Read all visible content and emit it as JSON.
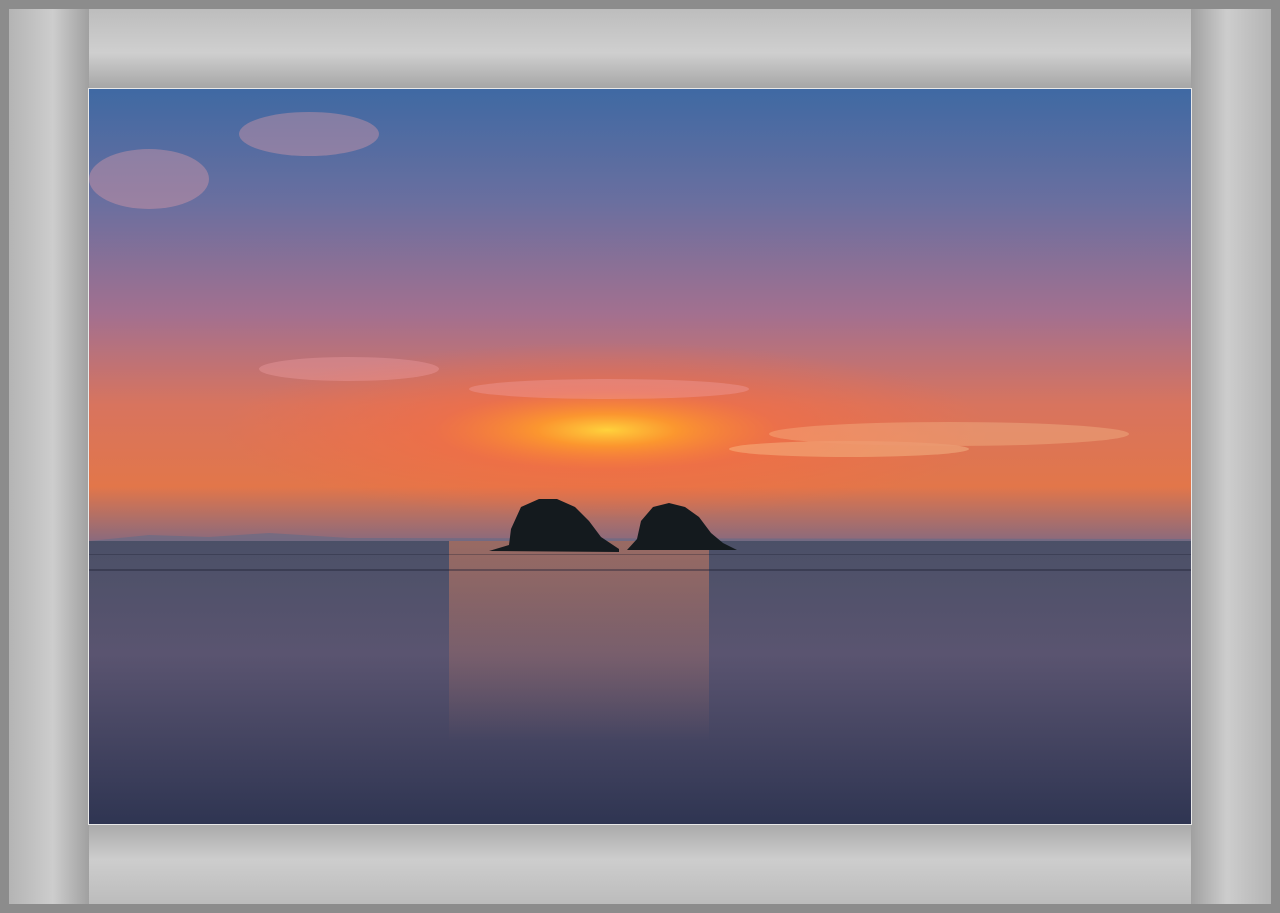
{
  "image": {
    "subject": "sunset-over-sea-with-two-islets",
    "colors": {
      "sky_top": "#4a6fa6",
      "sky_mid": "#8a6f9a",
      "glow": "#ff7a2e",
      "sun_core": "#ffc23a",
      "sea": "#3e4360",
      "frame": "#8c8c8c",
      "mat": "#c9c9c9"
    }
  }
}
